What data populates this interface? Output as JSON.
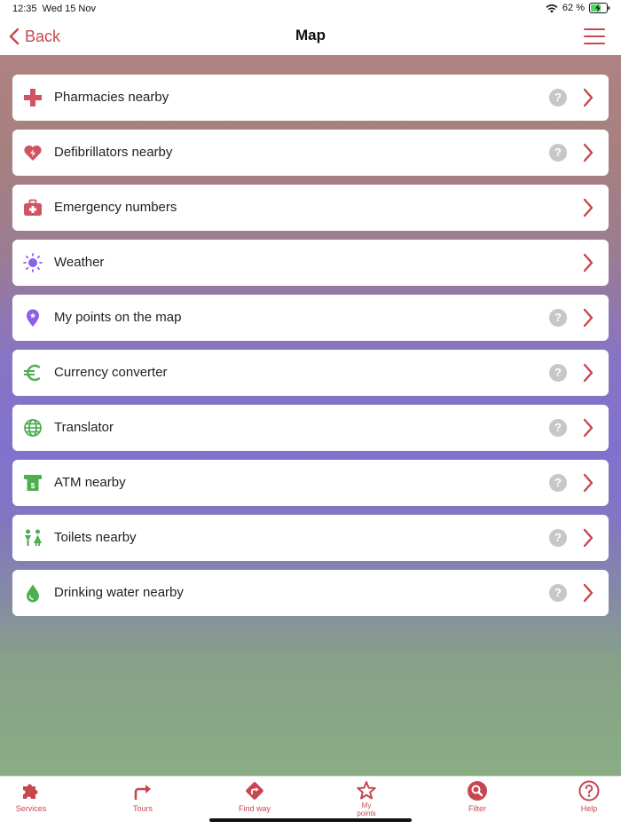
{
  "status_bar": {
    "time": "12:35",
    "date": "Wed 15 Nov",
    "battery": "62 %"
  },
  "nav": {
    "back_label": "Back",
    "title": "Map"
  },
  "colors": {
    "accent": "#c8474f",
    "red_icon": "#d05462",
    "purple_icon": "#8a62e8",
    "green_icon": "#4caf50",
    "help_grey": "#c7c7c7"
  },
  "services": [
    {
      "label": "Pharmacies nearby",
      "icon": "pharmacy-cross-icon",
      "has_help": true,
      "help_symbol": "?"
    },
    {
      "label": "Defibrillators nearby",
      "icon": "heart-defibrillator-icon",
      "has_help": true,
      "help_symbol": "?"
    },
    {
      "label": "Emergency numbers",
      "icon": "first-aid-kit-icon",
      "has_help": false
    },
    {
      "label": "Weather",
      "icon": "sun-icon",
      "has_help": false
    },
    {
      "label": "My points on the map",
      "icon": "map-pin-icon",
      "has_help": true,
      "help_symbol": "?"
    },
    {
      "label": "Currency converter",
      "icon": "euro-icon",
      "has_help": true,
      "help_symbol": "?"
    },
    {
      "label": "Translator",
      "icon": "globe-icon",
      "has_help": true,
      "help_symbol": "?"
    },
    {
      "label": "ATM nearby",
      "icon": "atm-icon",
      "has_help": true,
      "help_symbol": "?"
    },
    {
      "label": "Toilets nearby",
      "icon": "toilets-icon",
      "has_help": true,
      "help_symbol": "?"
    },
    {
      "label": "Drinking water nearby",
      "icon": "water-drop-icon",
      "has_help": true,
      "help_symbol": "?"
    }
  ],
  "tabs": [
    {
      "label": "Services",
      "icon": "puzzle-icon"
    },
    {
      "label": "Tours",
      "icon": "route-arrow-icon"
    },
    {
      "label": "Find way",
      "icon": "directions-icon"
    },
    {
      "label": "My\npoints",
      "label_line1": "My",
      "label_line2": "points",
      "icon": "star-icon"
    },
    {
      "label": "Filter",
      "icon": "search-icon"
    },
    {
      "label": "Help",
      "icon": "help-circle-icon"
    }
  ]
}
